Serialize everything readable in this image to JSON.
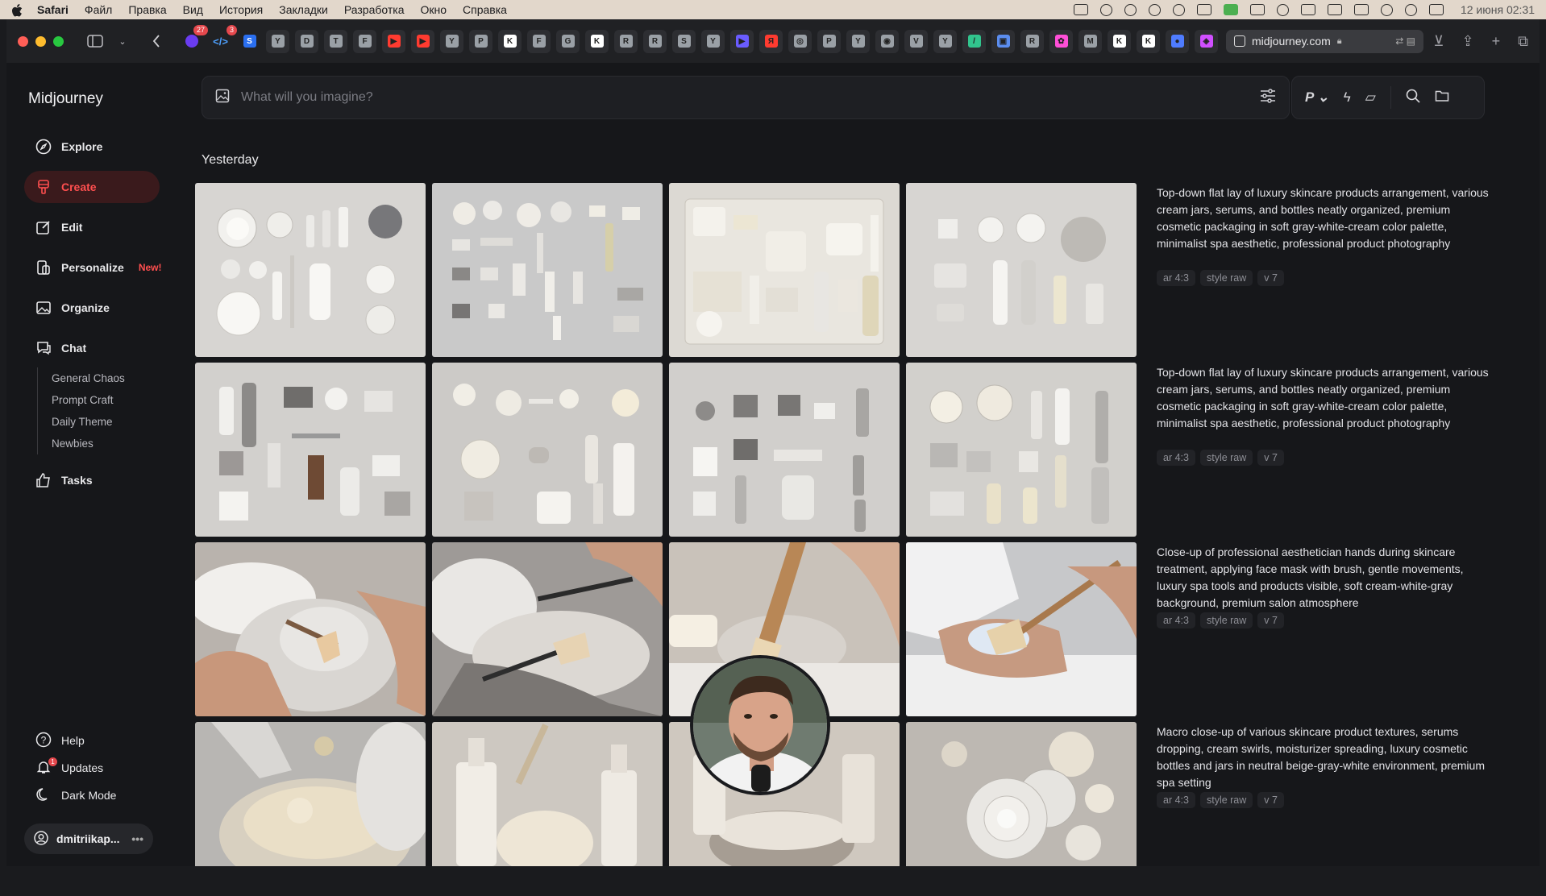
{
  "menubar": {
    "app": "Safari",
    "items": [
      "Файл",
      "Правка",
      "Вид",
      "История",
      "Закладки",
      "Разработка",
      "Окно",
      "Справка"
    ],
    "clock": "12 июня 02:31"
  },
  "browser": {
    "url": "midjourney.com",
    "tab_badges": {
      "tab1": "27",
      "tab2": "3"
    },
    "tab_letters": [
      "Y",
      "D",
      "T",
      "F",
      "▶",
      "▶",
      "Y",
      "P",
      "K",
      "F",
      "G",
      "K",
      "R",
      "R",
      "S",
      "Y",
      "▶",
      "Я",
      "◎",
      "P",
      "Y",
      "◉",
      "V",
      "Y",
      "/",
      "▣",
      "R",
      "✿",
      "M",
      "K",
      "K",
      "●",
      "◈"
    ]
  },
  "sidebar": {
    "brand": "Midjourney",
    "items": [
      {
        "label": "Explore",
        "icon": "compass-icon"
      },
      {
        "label": "Create",
        "icon": "brush-icon"
      },
      {
        "label": "Edit",
        "icon": "edit-icon"
      },
      {
        "label": "Personalize",
        "icon": "personalize-icon",
        "badge": "New!"
      },
      {
        "label": "Organize",
        "icon": "image-icon"
      },
      {
        "label": "Chat",
        "icon": "chat-icon"
      }
    ],
    "chat_rooms": [
      "General Chaos",
      "Prompt Craft",
      "Daily Theme",
      "Newbies"
    ],
    "tasks": "Tasks",
    "bottom": [
      {
        "label": "Help",
        "icon": "help-icon"
      },
      {
        "label": "Updates",
        "icon": "bell-icon",
        "badge": "1"
      },
      {
        "label": "Dark Mode",
        "icon": "moon-icon"
      }
    ],
    "user": "dmitriikap..."
  },
  "search": {
    "placeholder": "What will you imagine?"
  },
  "feed": {
    "section": "Yesterday",
    "rows": [
      {
        "prompt": "Top-down flat lay of luxury skincare products arrangement, various cream jars, serums, and bottles neatly organized, premium cosmetic packaging in soft gray-white-cream color palette, minimalist spa aesthetic, professional product photography",
        "params": [
          "ar 4:3",
          "style raw",
          "v 7"
        ]
      },
      {
        "prompt": "Top-down flat lay of luxury skincare products arrangement, various cream jars, serums, and bottles neatly organized, premium cosmetic packaging in soft gray-white-cream color palette, minimalist spa aesthetic, professional product photography",
        "params": [
          "ar 4:3",
          "style raw",
          "v 7"
        ]
      },
      {
        "prompt": "Close-up of professional aesthetician hands during skincare treatment, applying face mask with brush, gentle movements, luxury spa tools and products visible, soft cream-white-gray background, premium salon atmosphere",
        "params": [
          "ar 4:3",
          "style raw",
          "v 7"
        ]
      },
      {
        "prompt": "Macro close-up of various skincare product textures, serums dropping, cream swirls, moisturizer spreading, luxury cosmetic bottles and jars in neutral beige-gray-white environment, premium spa setting",
        "params": [
          "ar 4:3",
          "style raw",
          "v 7"
        ]
      }
    ]
  },
  "colors": {
    "accent": "#ff4f4f",
    "bg": "#16171a"
  }
}
